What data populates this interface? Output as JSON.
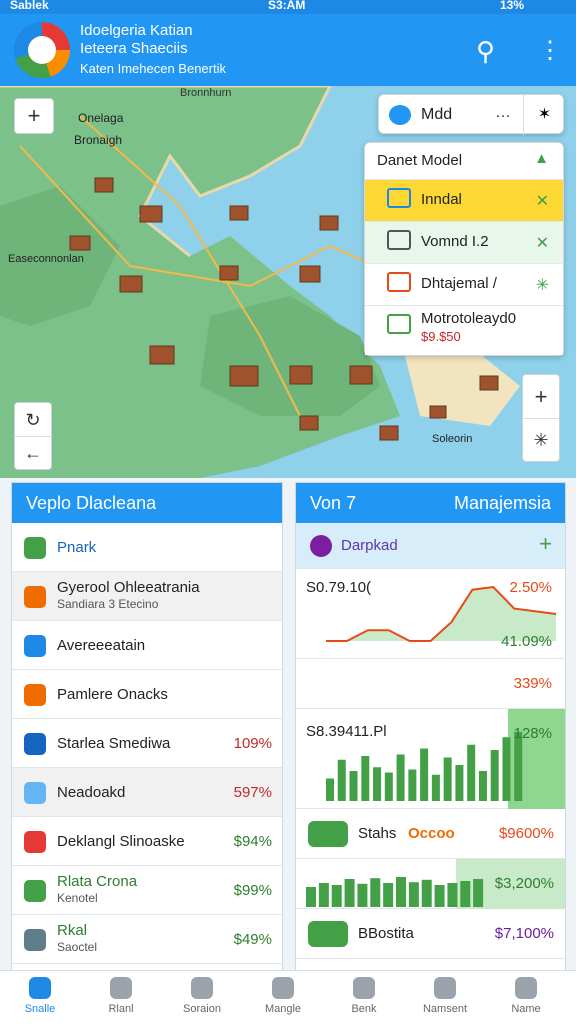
{
  "status": {
    "left": "Sablek",
    "time": "S3:AM",
    "battery": "13%"
  },
  "header": {
    "line1": "Idoelgeria Katian",
    "line2": "Ieteera Shaeciis",
    "line3": "Katen Imehecen Benertik"
  },
  "map": {
    "labels": [
      "Bronnhurn",
      "Onelaga",
      "Bronaigh",
      "Easeconnonlan",
      "Soleorin"
    ],
    "zoom_in": "+",
    "compass": "✳",
    "refresh": "↻",
    "back": "←",
    "plus2": "+",
    "star2": "✳"
  },
  "layers": {
    "search_label": "Mdd",
    "title": "Danet Model",
    "items": [
      {
        "label": "Inndal",
        "action": "✕",
        "color": "#1e88e5",
        "bg": "#fdd835"
      },
      {
        "label": "Vomnd I.2",
        "action": "✕",
        "color": "#555",
        "bg": "#e8f6ec"
      },
      {
        "label": "Dhtajemal /",
        "action": "✳",
        "color": "#e64a19",
        "bg": "#ffffff"
      },
      {
        "label": "Motrotoleayd0",
        "sub": "$9.$50",
        "action": "",
        "color": "#43a047",
        "bg": "#ffffff"
      }
    ]
  },
  "left_card": {
    "title": "Veplo Dlacleana",
    "rows": [
      {
        "label": "Pnark",
        "value": "",
        "icon": "#43a047",
        "bg": "#ffffff",
        "color": "#1565c0"
      },
      {
        "label": "Gyerool Ohleeatrania",
        "sub": "Sandiara 3 Etecino",
        "value": "",
        "icon": "#ef6c00",
        "bg": "#f1f1f1",
        "color": "#222"
      },
      {
        "label": "Avereeeatain",
        "value": "",
        "icon": "#1e88e5",
        "bg": "#ffffff",
        "color": "#222"
      },
      {
        "label": "Pamlere Onacks",
        "value": "",
        "icon": "#ef6c00",
        "bg": "#ffffff",
        "color": "#222"
      },
      {
        "label": "Starlea Smediwa",
        "value": "109%",
        "icon": "#1565c0",
        "bg": "#ffffff",
        "color": "#c62828"
      },
      {
        "label": "Neadoakd",
        "value": "597%",
        "icon": "#64b5f6",
        "bg": "#f1f1f1",
        "color": "#c62828"
      },
      {
        "label": "Deklangl Slinoaske",
        "value": "$94%",
        "icon": "#e53935",
        "bg": "#ffffff",
        "color": "#2e7d32"
      },
      {
        "label": "Rlata Crona",
        "sub": "Kenotel",
        "value": "$99%",
        "icon": "#43a047",
        "bg": "#ffffff",
        "color": "#2e7d32"
      },
      {
        "label": "Rkal",
        "sub": "Saoctel",
        "value": "$49%",
        "icon": "#607d8b",
        "bg": "#ffffff",
        "color": "#2e7d32"
      }
    ]
  },
  "right_card": {
    "title_left": "Von 7",
    "title_right": "Manajemsia",
    "sub_label": "Darpkad",
    "add": "+",
    "chart1": {
      "value": "S0.79.10(",
      "pct1": "2.50%",
      "pct2": "41.09%"
    },
    "row_pct": "339%",
    "chart2": {
      "value": "S8.39411.Pl",
      "pct": "128%"
    },
    "stats_label": "Stahs",
    "stats_dots": "Occoo",
    "stats_pct": "$9600%",
    "chart3_pct": "$3,200%",
    "bottom_label": "BBostita",
    "bottom_pct": "$7,100%"
  },
  "chart_data": [
    {
      "type": "line",
      "values": [
        0,
        0,
        0.2,
        0.2,
        0,
        0,
        0.35,
        0.95,
        1,
        0.6,
        0.55,
        0.5
      ]
    },
    {
      "type": "bar",
      "values": [
        30,
        55,
        40,
        60,
        45,
        38,
        62,
        42,
        70,
        35,
        58,
        48,
        75,
        40,
        68,
        85,
        92
      ]
    },
    {
      "type": "bar",
      "values": [
        50,
        60,
        55,
        70,
        58,
        72,
        60,
        75,
        62,
        68,
        55,
        60,
        65,
        70
      ]
    }
  ],
  "nav": [
    {
      "label": "Snalle"
    },
    {
      "label": "Rlanl"
    },
    {
      "label": "Soraion"
    },
    {
      "label": "Mangle"
    },
    {
      "label": "Benk"
    },
    {
      "label": "Namsent"
    },
    {
      "label": "Name"
    }
  ]
}
